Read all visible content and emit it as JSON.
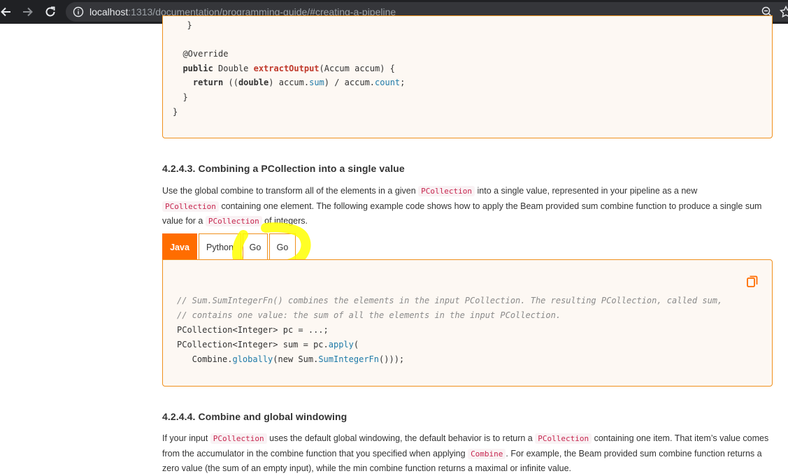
{
  "browser": {
    "url_host": "localhost",
    "url_path": ":1313/documentation/programming-guide/#creating-a-pipeline"
  },
  "code_top": {
    "lines": [
      "  }",
      "",
      "  @Override",
      "  public Double extractOutput(Accum accum) {",
      "    return ((double) accum.sum) / accum.count;",
      "  }",
      "}"
    ]
  },
  "section_1": {
    "heading": "4.2.4.3. Combining a PCollection into a single value",
    "p1": "Use the global combine to transform all of the elements in a given ",
    "c1": "PCollection",
    "p2": " into a single value, represented in your pipeline as a new",
    "c2": "PCollection",
    "p3": " containing one element. The following example code shows how to apply the Beam provided sum combine function to produce a single sum value for a ",
    "c3": "PCollection",
    "p4": " of integers."
  },
  "tabs": [
    {
      "label": "Java",
      "active": true
    },
    {
      "label": "Python",
      "active": false
    },
    {
      "label": "Go",
      "active": false
    },
    {
      "label": "Go",
      "active": false
    }
  ],
  "code_bottom": {
    "comment1": "// Sum.SumIntegerFn() combines the elements in the input PCollection. The resulting PCollection, called sum,",
    "comment2": "// contains one value: the sum of all the elements in the input PCollection.",
    "line3": "PCollection<Integer> pc = ...;",
    "line4a": "PCollection<Integer> sum = pc.",
    "line4b": "apply",
    "line4c": "(",
    "line5a": "   Combine.",
    "line5b": "globally",
    "line5c": "(new Sum.",
    "line5d": "SumIntegerFn",
    "line5e": "()));"
  },
  "section_2": {
    "heading": "4.2.4.4. Combine and global windowing",
    "p1": "If your input ",
    "c1": "PCollection",
    "p2": " uses the default global windowing, the default behavior is to return a ",
    "c2": "PCollection",
    "p3": " containing one item. That item’s value comes from the accumulator in the combine function that you specified when applying ",
    "c3": "Combine",
    "p4": ". For example, the Beam provided sum combine function returns a zero value (the sum of an empty input), while the min combine function returns a maximal or infinite value."
  },
  "colors": {
    "accent": "#ff6d00",
    "border": "#f0901c",
    "highlight": "#ffff00"
  }
}
